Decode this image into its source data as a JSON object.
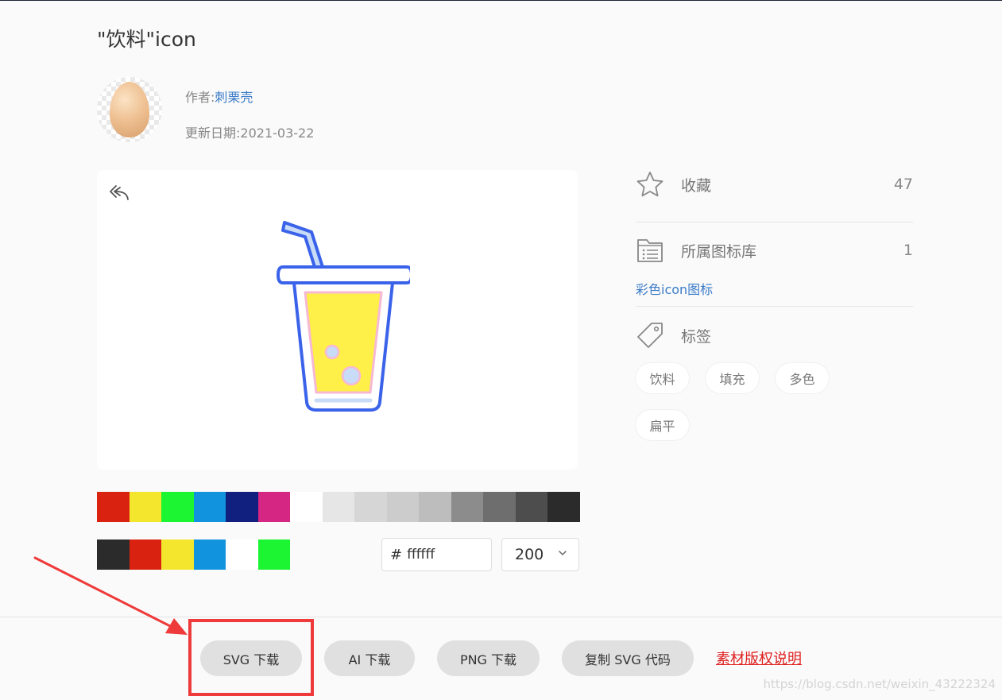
{
  "title": "\"饮料\"icon",
  "author": {
    "label": "作者:",
    "name": "刺栗壳"
  },
  "update": {
    "label": "更新日期:",
    "date": "2021-03-22"
  },
  "colors": {
    "row1": [
      "#d9220f",
      "#f4e62d",
      "#1cf531",
      "#1293dd",
      "#11207e",
      "#d42682",
      "#ffffff",
      "#e6e6e6",
      "#d6d6d6",
      "#cccccc",
      "#bdbdbd",
      "#8c8c8c",
      "#6e6e6e",
      "#4d4d4d",
      "#2b2b2b"
    ],
    "row2": [
      "#2b2b2b",
      "#d9220f",
      "#f4e62d",
      "#1293dd",
      "#ffffff",
      "#1cf531"
    ]
  },
  "hex_input": {
    "value": "ffffff",
    "hash": "#"
  },
  "size_select": {
    "value": "200"
  },
  "sidebar": {
    "favorite": {
      "label": "收藏",
      "count": "47"
    },
    "library": {
      "label": "所属图标库",
      "count": "1",
      "link": "彩色icon图标"
    },
    "tags": {
      "label": "标签",
      "items": [
        "饮料",
        "填充",
        "多色",
        "扁平"
      ]
    }
  },
  "buttons": {
    "svg": "SVG 下载",
    "ai": "AI 下载",
    "png": "PNG 下载",
    "copy_svg": "复制 SVG 代码",
    "copyright": "素材版权说明"
  },
  "watermark": "https://blog.csdn.net/weixin_43222324"
}
